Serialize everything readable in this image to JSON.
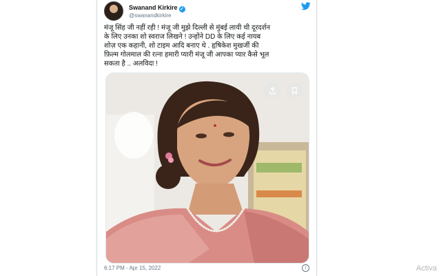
{
  "tweet": {
    "author_name": "Swanand Kirkire",
    "author_handle": "@swanandkirkire",
    "text": "मंजू सिंह जी नहीं रही ! मंजू जी मुझे दिल्ली से मुंबई लायी थी दूरदर्शन\nके लिए उनका शो स्वराज लिखने ! उन्होंने DD के लिए कई नायब\nशोज़ एक कहानी, शो टाइम आदि बनाए थे .  हृषिकेश मुखर्जी की\nफ़िल्म गोलमाल की रत्ना हमारी प्यारी मंजू जी आपका प्यार कैसे भूल\nसकता है .. अलविदा !",
    "timestamp": "6:17 PM - Apr 15, 2022"
  },
  "icons": {
    "verified": "verified-badge-icon",
    "brand": "twitter-bird-icon",
    "share": "share-icon",
    "bookmark": "bookmark-icon",
    "info": "info-icon"
  },
  "watermark_text": "Activa",
  "colors": {
    "twitter_blue": "#1d9bf0",
    "text_primary": "#14171a",
    "text_secondary": "#657786"
  }
}
